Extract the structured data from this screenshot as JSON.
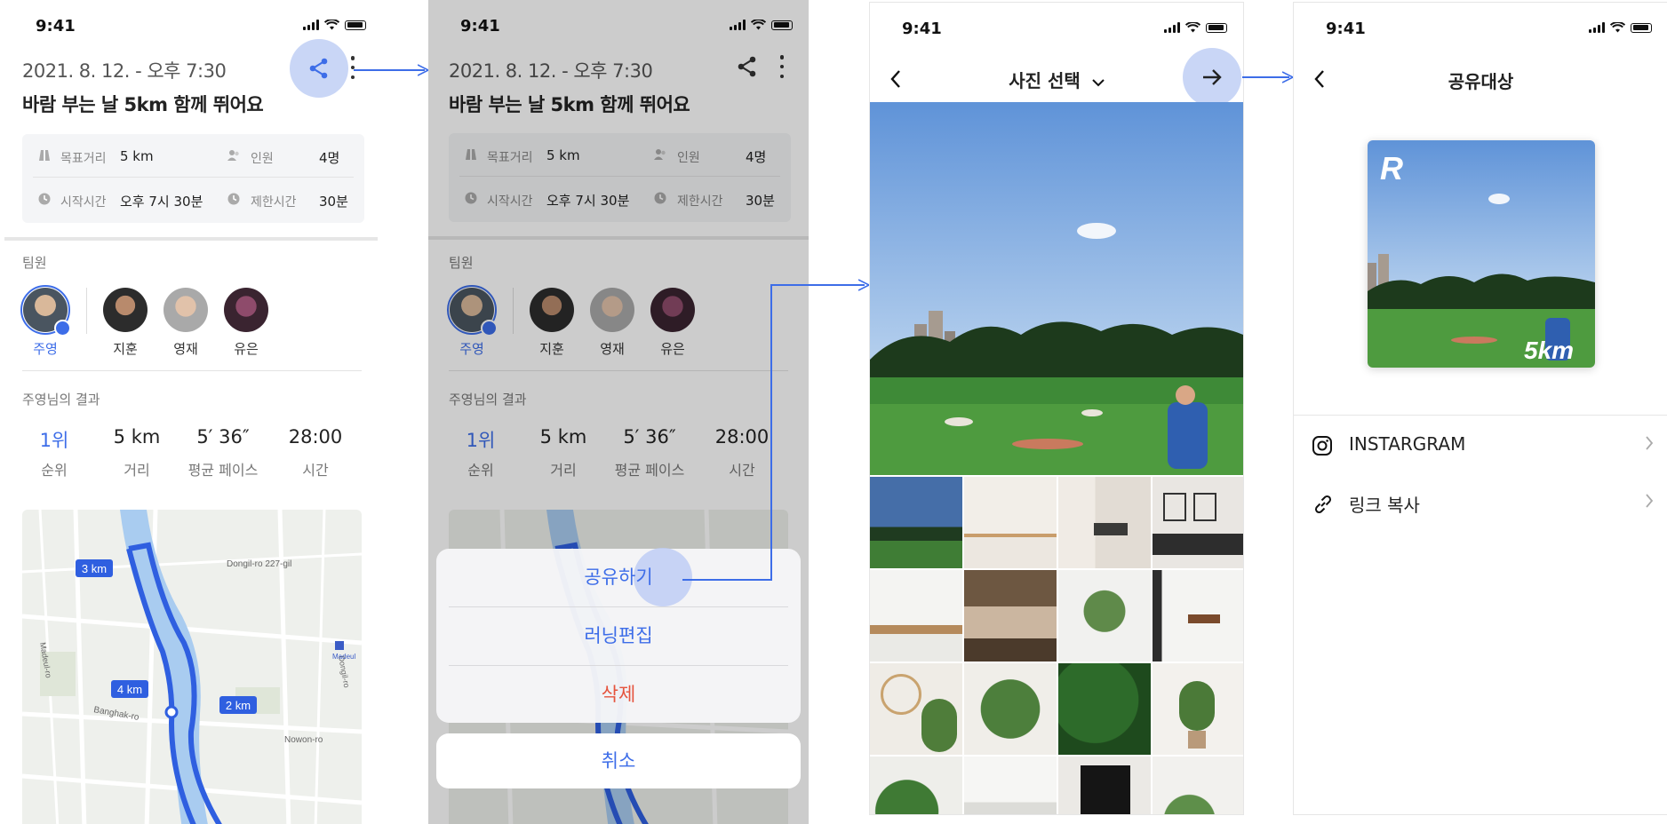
{
  "status": {
    "time": "9:41"
  },
  "run": {
    "date": "2021. 8. 12. - 오후 7:30",
    "title": "바람 부는 날 5km 함께 뛰어요",
    "info": {
      "distance_label": "목표거리",
      "distance_value": "5 km",
      "people_label": "인원",
      "people_value": "4명",
      "start_label": "시작시간",
      "start_value": "오후 7시 30분",
      "limit_label": "제한시간",
      "limit_value": "30분"
    },
    "team_label": "팀원",
    "members": [
      "주영",
      "지훈",
      "영재",
      "유은"
    ],
    "result_label": "주영님의 결과",
    "stats": [
      {
        "value": "1위",
        "label": "순위"
      },
      {
        "value": "5 km",
        "label": "거리"
      },
      {
        "value": "5′ 36″",
        "label": "평균 페이스"
      },
      {
        "value": "28:00",
        "label": "시간"
      }
    ],
    "map": {
      "markers": [
        "3 km",
        "4 km",
        "2 km"
      ],
      "labels": [
        "Dongil-ro 227-gil",
        "Madeul-ro",
        "Banghak-ro",
        "Nowon-ro",
        "Dongil-ro",
        "Madeul",
        "Nowon-ro"
      ]
    }
  },
  "sheet": {
    "share": "공유하기",
    "edit": "러닝편집",
    "delete": "삭제",
    "cancel": "취소"
  },
  "photo_select": {
    "title": "사진 선택"
  },
  "share_target": {
    "title": "공유대상",
    "card_badge": "5km",
    "card_logo": "R",
    "options": [
      "INSTARGRAM",
      "링크 복사"
    ]
  },
  "colors": {
    "accent": "#3d6de8",
    "danger": "#e5533d",
    "highlight": "#c9d6f6"
  }
}
